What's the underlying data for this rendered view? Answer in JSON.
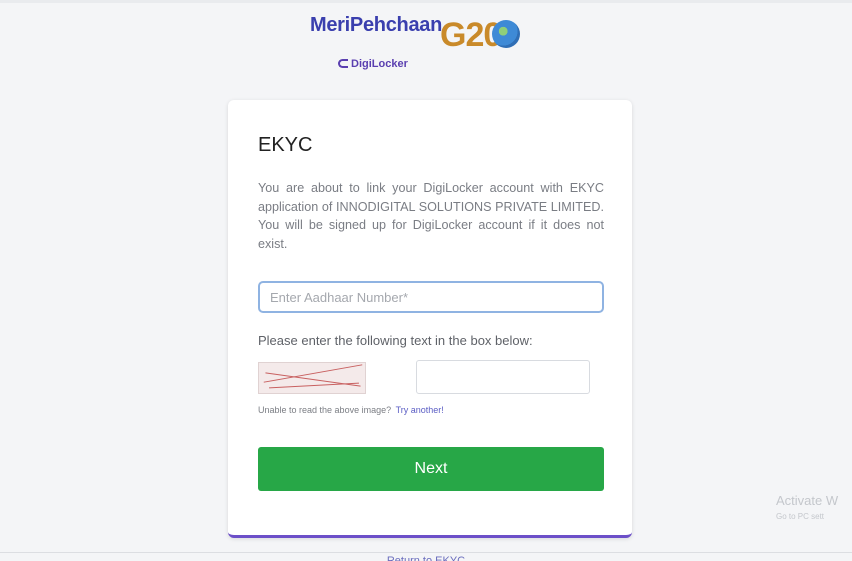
{
  "header": {
    "meripehchaan": "MeriPehchaan",
    "digilocker": "DigiLocker",
    "g20": "G20"
  },
  "card": {
    "title": "EKYC",
    "description": "You are about to link your DigiLocker account with EKYC application of INNODIGITAL SOLUTIONS PRIVATE LIMITED. You will be signed up for DigiLocker account if it does not exist.",
    "aadhaar_placeholder": "Enter Aadhaar Number*",
    "aadhaar_value": "",
    "captcha_instruction": "Please enter the following text in the box below:",
    "captcha_value": "",
    "captcha_help": "Unable to read the above image?",
    "captcha_try_another": "Try another!",
    "next_label": "Next"
  },
  "footer": {
    "return_link": "Return to EKYC"
  },
  "watermark": {
    "line1": "Activate W",
    "line2": "Go to PC sett"
  },
  "colors": {
    "accent_purple": "#6c4fc8",
    "button_green": "#27a747",
    "input_focus_border": "#8fb3e2",
    "brand_blue": "#3a3fae"
  }
}
